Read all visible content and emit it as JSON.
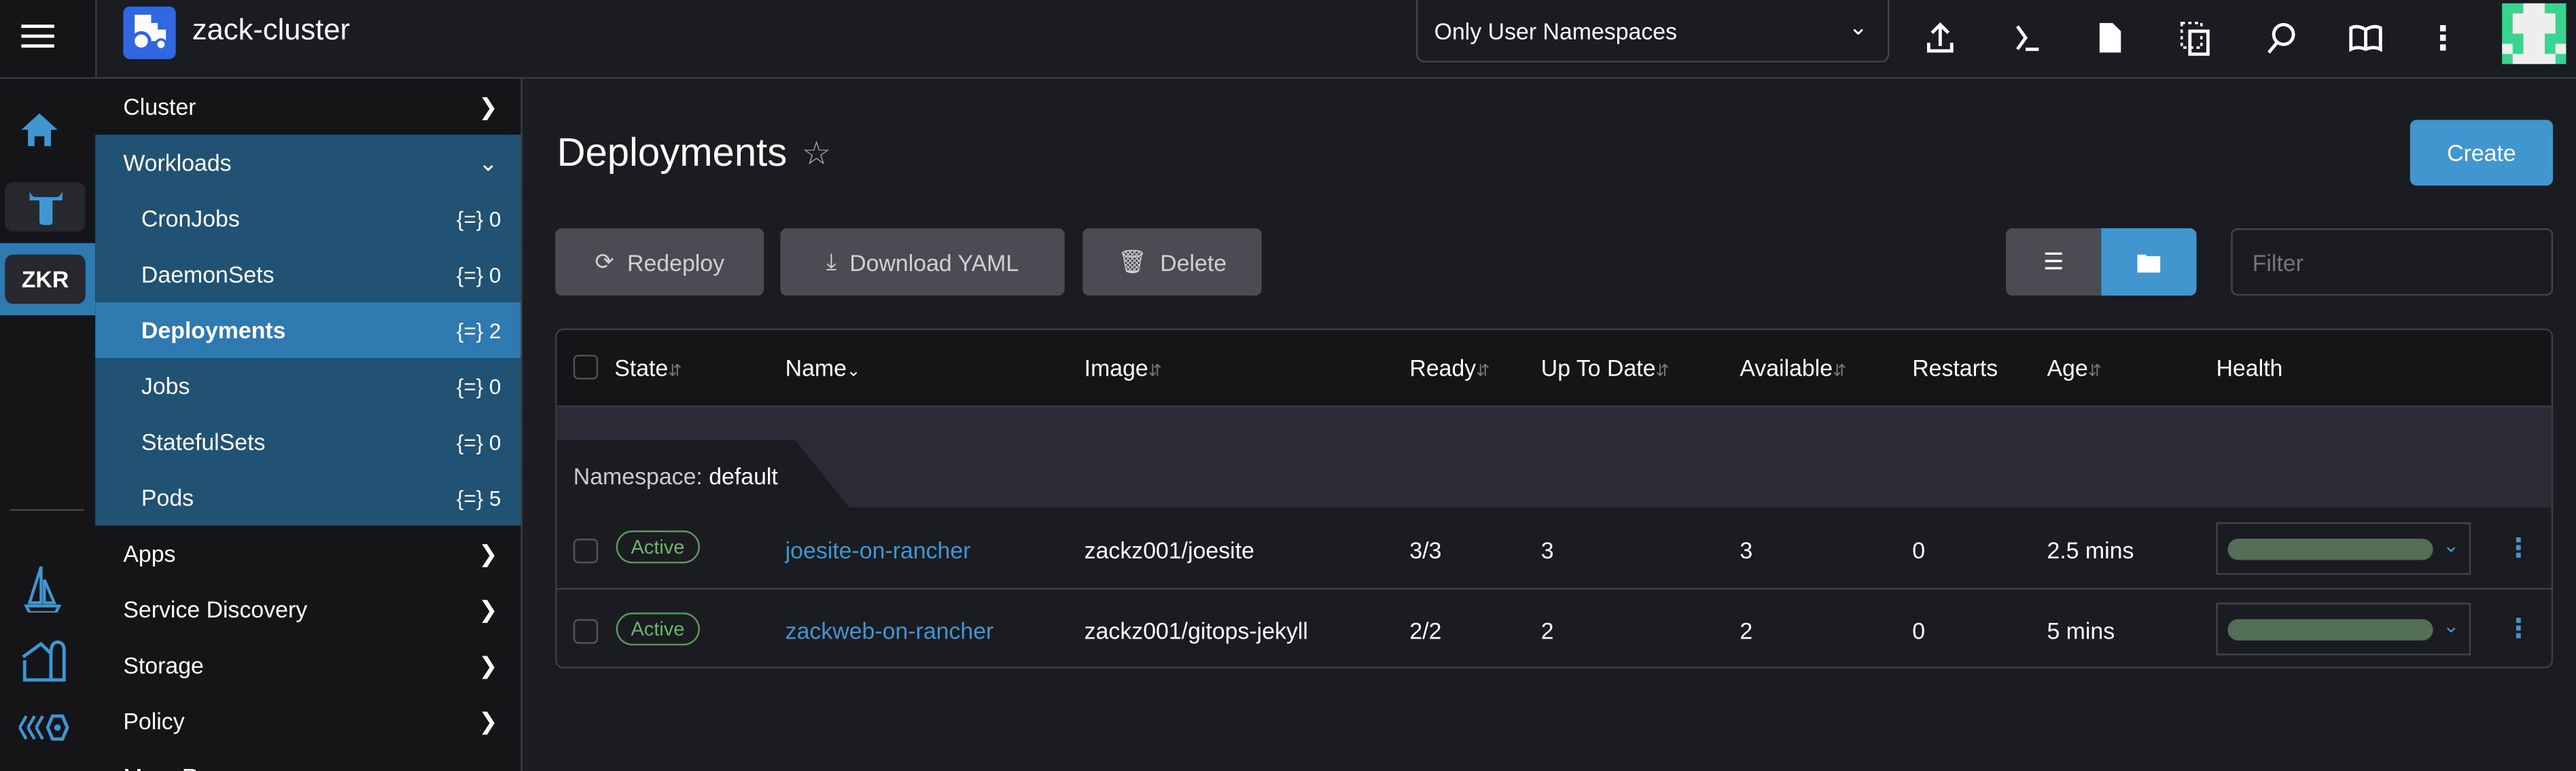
{
  "header": {
    "cluster_name": "zack-cluster",
    "namespace_filter": "Only User Namespaces",
    "icons": [
      "upload-icon",
      "terminal-icon",
      "file-icon",
      "copy-config-icon",
      "search-icon",
      "docs-book-icon",
      "more-vertical-icon"
    ]
  },
  "rail": {
    "cluster_badge": "ZKR",
    "icons": [
      "home-icon",
      "rancher-bull-icon",
      "fleet-sailboat-icon",
      "harvester-icon",
      "extensions-icon"
    ]
  },
  "nav": {
    "items": [
      {
        "label": "Cluster",
        "type": "group"
      },
      {
        "label": "Workloads",
        "type": "group-open"
      },
      {
        "label": "CronJobs",
        "count": "0"
      },
      {
        "label": "DaemonSets",
        "count": "0"
      },
      {
        "label": "Deployments",
        "count": "2",
        "selected": true
      },
      {
        "label": "Jobs",
        "count": "0"
      },
      {
        "label": "StatefulSets",
        "count": "0"
      },
      {
        "label": "Pods",
        "count": "5"
      },
      {
        "label": "Apps",
        "type": "group"
      },
      {
        "label": "Service Discovery",
        "type": "group"
      },
      {
        "label": "Storage",
        "type": "group"
      },
      {
        "label": "Policy",
        "type": "group"
      },
      {
        "label": "More Resources",
        "type": "group"
      }
    ]
  },
  "main": {
    "title": "Deployments",
    "create_label": "Create",
    "redeploy_label": "Redeploy",
    "download_label": "Download YAML",
    "delete_label": "Delete",
    "filter_placeholder": "Filter",
    "columns": [
      "State",
      "Name",
      "Image",
      "Ready",
      "Up To Date",
      "Available",
      "Restarts",
      "Age",
      "Health"
    ],
    "group_label": "Namespace:",
    "group_value": "default",
    "rows": [
      {
        "state": "Active",
        "name": "joesite-on-rancher",
        "image": "zackz001/joesite",
        "ready": "3/3",
        "uptodate": "3",
        "available": "3",
        "restarts": "0",
        "age": "2.5 mins"
      },
      {
        "state": "Active",
        "name": "zackweb-on-rancher",
        "image": "zackz001/gitops-jekyll",
        "ready": "2/2",
        "uptodate": "2",
        "available": "2",
        "restarts": "0",
        "age": "5 mins"
      }
    ]
  },
  "colors": {
    "accent": "#4296cf",
    "nav_open": "#1f5273",
    "nav_selected": "#2e7ab0",
    "active": "#6cb56c",
    "health": "#526e55"
  }
}
